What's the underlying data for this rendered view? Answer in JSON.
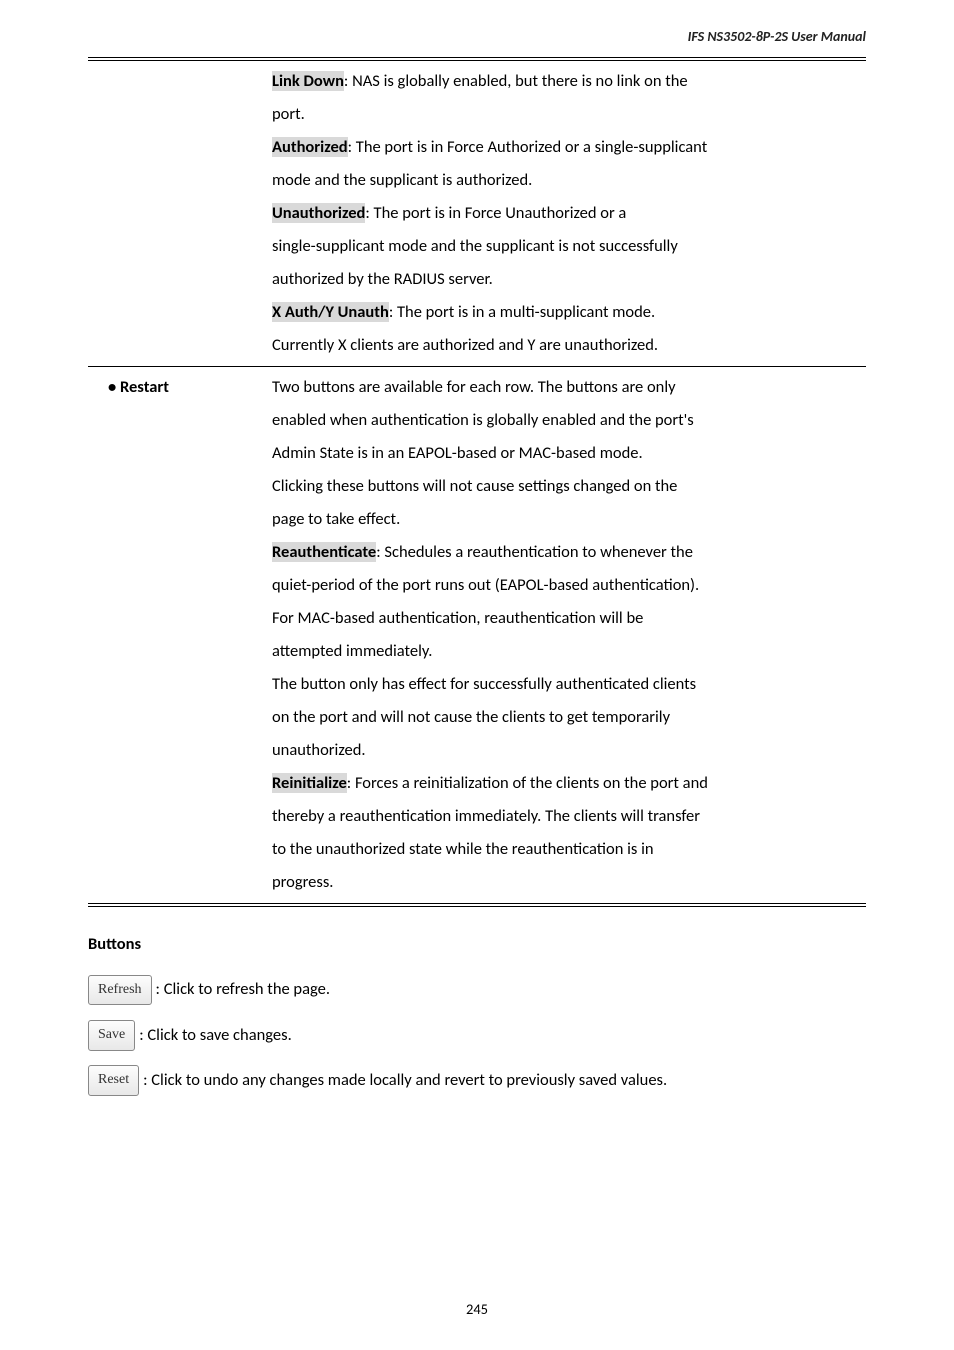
{
  "header": {
    "text": "IFS  NS3502-8P-2S  User  Manual"
  },
  "table": {
    "row1_desc": {
      "linkdown_label": "Link Down",
      "linkdown_tail": ": NAS is globally enabled, but there is no link on the",
      "port_line": "port.",
      "authorized_label": "Authorized",
      "authorized_tail": ": The port is in Force Authorized or a single-supplicant",
      "mode_line": "mode and the supplicant is authorized.",
      "unauth_label": "Unauthorized",
      "unauth_tail": ": The port is in Force Unauthorized or a",
      "single_supp_line": "single-supplicant mode and the supplicant is not successfully",
      "authorized_by": "authorized by the RADIUS server.",
      "xauth_label": "X Auth/Y Unauth",
      "xauth_tail": ": The port is in a multi-supplicant mode.",
      "currently_line": "Currently X clients are authorized and Y are unauthorized."
    },
    "row2_label": "•  Restart",
    "row2_desc": {
      "l1": "Two buttons are available for each row. The buttons are only",
      "l2": "enabled when authentication is globally enabled and the port's",
      "l3": "Admin State is in an EAPOL-based or MAC-based mode.",
      "l4": "Clicking these buttons will not cause settings changed on the",
      "l5": "page to take effect.",
      "reauth_label": "Reauthenticate",
      "reauth_tail": ": Schedules a reauthentication to whenever the",
      "l7": "quiet-period of the port runs out (EAPOL-based authentication).",
      "l8": "For MAC-based authentication, reauthentication will be",
      "l9": "attempted immediately.",
      "l10": "The button only has effect for successfully authenticated clients",
      "l11": "on the port and will not cause the clients to get temporarily",
      "l12": "unauthorized.",
      "reinit_label": "Reinitialize",
      "reinit_tail": ": Forces a reinitialization of the clients on the port and",
      "l14": "thereby a reauthentication immediately. The clients will transfer",
      "l15": "to the unauthorized state while the reauthentication is in",
      "l16": "progress."
    }
  },
  "buttons": {
    "heading": "Buttons",
    "refresh_btn": "Refresh",
    "refresh_text": ": Click to refresh the page.",
    "save_btn": "Save",
    "save_text": ": Click to save changes.",
    "reset_btn": "Reset",
    "reset_text": ": Click to undo any changes made locally and revert to previously saved values."
  },
  "page_number": "245"
}
